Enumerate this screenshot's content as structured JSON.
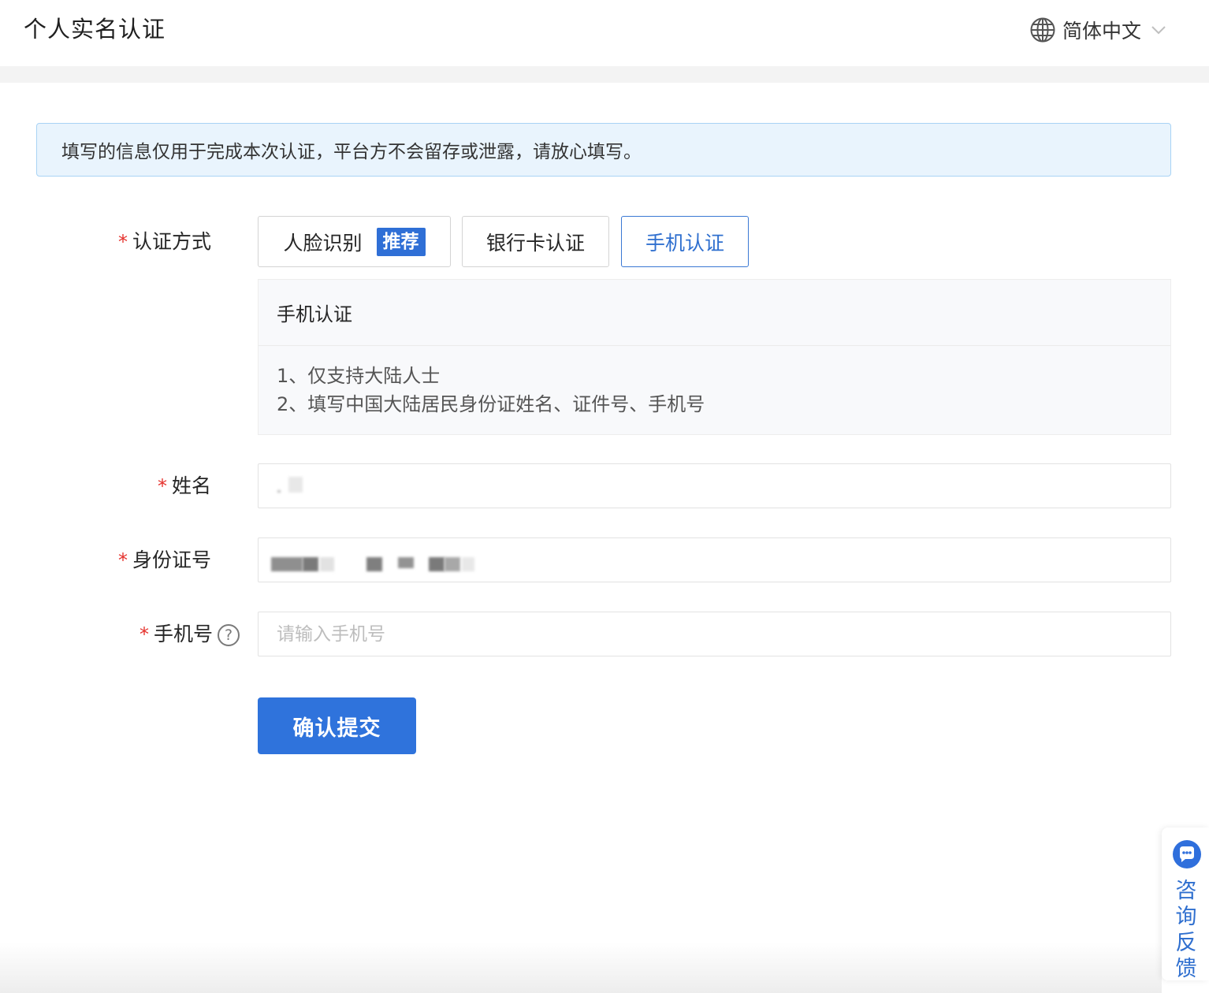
{
  "header": {
    "title": "个人实名认证",
    "language": "简体中文"
  },
  "notice": "填写的信息仅用于完成本次认证，平台方不会留存或泄露，请放心填写。",
  "form": {
    "required_mark": "*",
    "method_label": "认证方式",
    "methods": [
      {
        "label": "人脸识别",
        "badge": "推荐",
        "selected": false
      },
      {
        "label": "银行卡认证",
        "selected": false
      },
      {
        "label": "手机认证",
        "selected": true
      }
    ],
    "panel": {
      "title": "手机认证",
      "lines": [
        "1、仅支持大陆人士",
        "2、填写中国大陆居民身份证姓名、证件号、手机号"
      ]
    },
    "name_label": "姓名",
    "id_label": "身份证号",
    "phone_label": "手机号",
    "phone_help": "?",
    "phone_placeholder": "请输入手机号",
    "submit_label": "确认提交"
  },
  "feedback": {
    "label": "咨询反馈"
  },
  "colors": {
    "primary": "#2f73dc",
    "required": "#e5322d",
    "notice_bg": "#e9f4fd"
  }
}
